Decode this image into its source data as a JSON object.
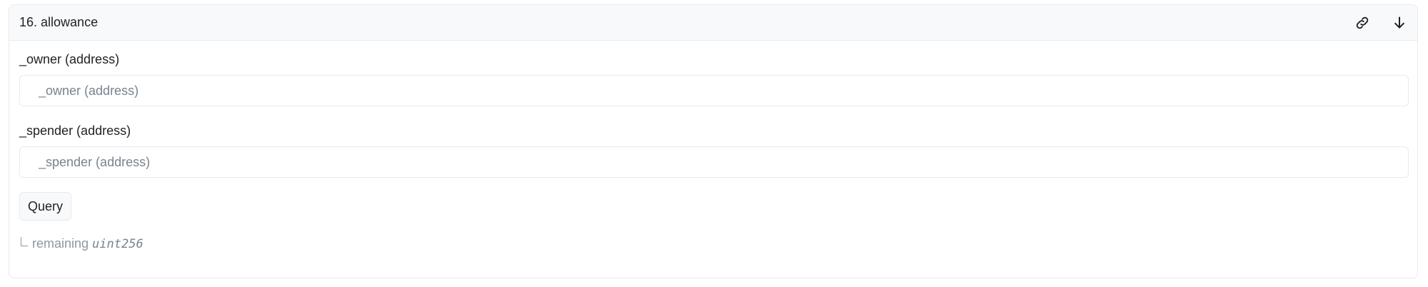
{
  "method": {
    "title": "16. allowance",
    "actions": {
      "link_icon": "link-icon",
      "download_icon": "arrow-down-icon"
    }
  },
  "inputs": [
    {
      "label": "_owner (address)",
      "placeholder": "_owner (address)",
      "value": ""
    },
    {
      "label": "_spender (address)",
      "placeholder": "_spender (address)",
      "value": ""
    }
  ],
  "query_button": {
    "label": "Query"
  },
  "result": {
    "name": "remaining",
    "type": "uint256"
  },
  "colors": {
    "border": "#e7eaf3",
    "header_bg": "#f8f9fa",
    "text": "#1e2022",
    "muted": "#8c98a4",
    "placeholder": "#77838f"
  }
}
